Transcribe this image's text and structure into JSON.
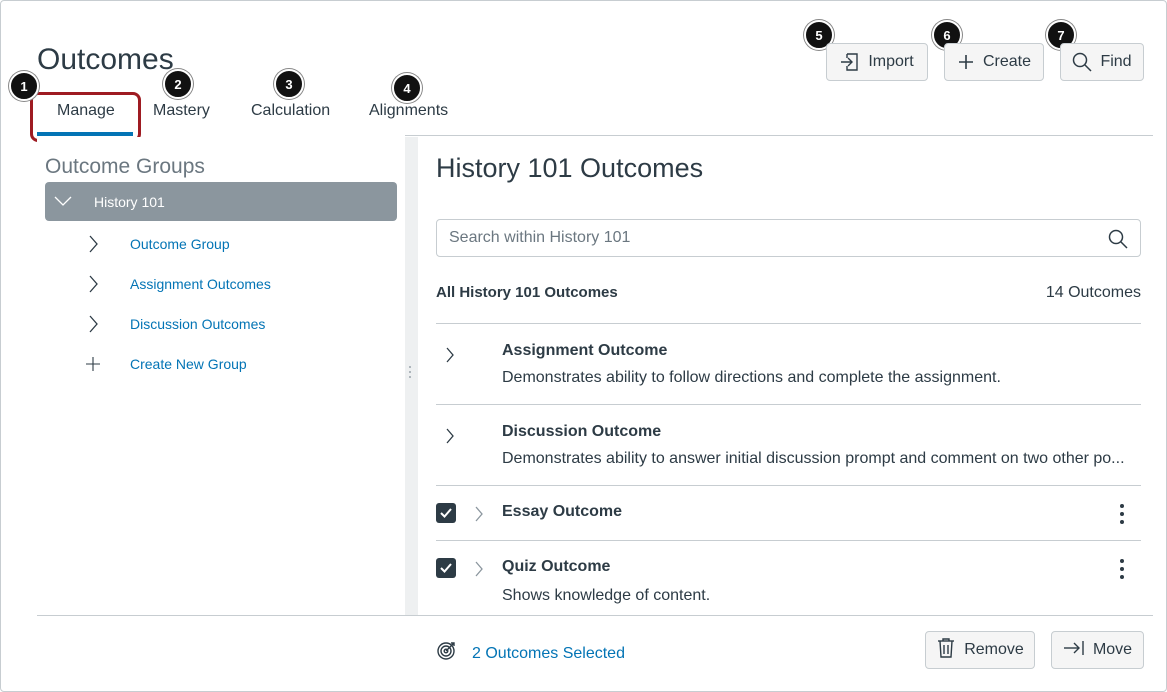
{
  "page": {
    "title": "Outcomes"
  },
  "tabs": [
    {
      "label": "Manage",
      "callout": "1",
      "active": true
    },
    {
      "label": "Mastery",
      "callout": "2"
    },
    {
      "label": "Calculation",
      "callout": "3"
    },
    {
      "label": "Alignments",
      "callout": "4"
    }
  ],
  "toolbar": {
    "import_label": "Import",
    "import_callout": "5",
    "create_label": "Create",
    "create_callout": "6",
    "find_label": "Find",
    "find_callout": "7"
  },
  "sidebar": {
    "title": "Outcome Groups",
    "root": {
      "label": "History 101",
      "icon": "chevron-down-icon"
    },
    "items": [
      {
        "label": "Outcome Group",
        "icon": "chevron-right-icon"
      },
      {
        "label": "Assignment Outcomes",
        "icon": "chevron-right-icon"
      },
      {
        "label": "Discussion Outcomes",
        "icon": "chevron-right-icon"
      },
      {
        "label": "Create New Group",
        "icon": "plus-icon"
      }
    ]
  },
  "main": {
    "title": "History 101 Outcomes",
    "search": {
      "placeholder": "Search within History 101",
      "value": ""
    },
    "list_header": {
      "label": "All History 101 Outcomes",
      "count": "14 Outcomes"
    },
    "outcomes": [
      {
        "name": "Assignment Outcome",
        "description": "Demonstrates ability to follow directions and complete the assignment.",
        "checked": false
      },
      {
        "name": "Discussion Outcome",
        "description": "Demonstrates ability to answer initial discussion prompt and comment on two other po...",
        "checked": false
      },
      {
        "name": "Essay Outcome",
        "description": "",
        "checked": true
      },
      {
        "name": "Quiz Outcome",
        "description": "Shows knowledge of content.",
        "checked": true
      }
    ]
  },
  "footer": {
    "selected_label": "2 Outcomes Selected",
    "remove_label": "Remove",
    "move_label": "Move"
  },
  "colors": {
    "link": "#0374b5",
    "text": "#2d3b45",
    "highlight": "#9e1b22",
    "tree_selected": "#8b969e"
  }
}
